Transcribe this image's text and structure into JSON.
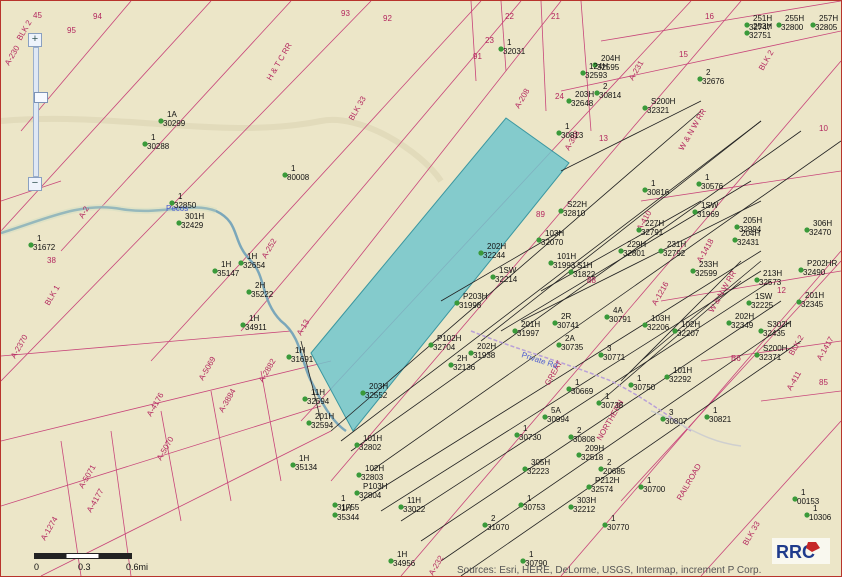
{
  "map": {
    "block_labels": [
      "BLK 2",
      "BLK 33",
      "BLK 1",
      "BLK 33",
      "BLK 2",
      "BLK 2",
      "BLK 33"
    ],
    "railroad_labels": [
      "H & T C RR",
      "W & N W RR",
      "W & N W RR",
      "NORTHERN",
      "RAILROAD",
      "GREAT"
    ],
    "survey_abstracts": [
      "A-230",
      "A-208",
      "A-388",
      "A-231",
      "A-2",
      "A-232",
      "A-252",
      "A-13",
      "A-2370",
      "A-5069",
      "A-2882",
      "A-3884",
      "A-4176",
      "A-5070",
      "A-5071",
      "A-4177",
      "A-1274",
      "A-1216",
      "A-1418",
      "A-410",
      "A-411",
      "A-1417",
      "A-232"
    ],
    "section_numbers": [
      "45",
      "95",
      "94",
      "93",
      "92",
      "91",
      "23",
      "22",
      "21",
      "16",
      "15",
      "24",
      "13",
      "10",
      "12",
      "B6",
      "85",
      "89",
      "88",
      "38"
    ],
    "well_labels": [
      {
        "id": "1",
        "api": "32031"
      },
      {
        "id": "204H",
        "api": "32595"
      },
      {
        "id": "124H",
        "api": "32593"
      },
      {
        "id": "2",
        "api": "30814"
      },
      {
        "id": "2",
        "api": "32676"
      },
      {
        "id": "251H",
        "api": "32747"
      },
      {
        "id": "253H",
        "api": "32751"
      },
      {
        "id": "255H",
        "api": "32800"
      },
      {
        "id": "257H",
        "api": "32805"
      },
      {
        "id": "203H",
        "api": "32648"
      },
      {
        "id": "1A",
        "api": "30299"
      },
      {
        "id": "1",
        "api": "30288"
      },
      {
        "id": "1",
        "api": "80008"
      },
      {
        "id": "1",
        "api": "30813"
      },
      {
        "id": "S200H",
        "api": "32321"
      },
      {
        "id": "1",
        "api": "32850"
      },
      {
        "id": "1",
        "api": "31672"
      },
      {
        "id": "301H",
        "api": "32429"
      },
      {
        "id": "1",
        "api": "30816"
      },
      {
        "id": "1",
        "api": "30576"
      },
      {
        "id": "1SW",
        "api": "31969"
      },
      {
        "id": "1H",
        "api": "32654"
      },
      {
        "id": "1H",
        "api": "35147"
      },
      {
        "id": "2H",
        "api": "35222"
      },
      {
        "id": "1H",
        "api": "34911"
      },
      {
        "id": "202H",
        "api": "32244"
      },
      {
        "id": "1SW",
        "api": "32214"
      },
      {
        "id": "S22H",
        "api": "32810"
      },
      {
        "id": "103H",
        "api": "32070"
      },
      {
        "id": "101H",
        "api": "31993"
      },
      {
        "id": "S1H",
        "api": "31822"
      },
      {
        "id": "227H",
        "api": "32791"
      },
      {
        "id": "229H",
        "api": "32801"
      },
      {
        "id": "231H",
        "api": "32792"
      },
      {
        "id": "233H",
        "api": "32599"
      },
      {
        "id": "205H",
        "api": "32994"
      },
      {
        "id": "204H",
        "api": "32431"
      },
      {
        "id": "213H",
        "api": "32573"
      },
      {
        "id": "306H",
        "api": "32470"
      },
      {
        "id": "P202HR",
        "api": "32490"
      },
      {
        "id": "P203H",
        "api": "31998"
      },
      {
        "id": "201H",
        "api": "31997"
      },
      {
        "id": "2R",
        "api": "30741"
      },
      {
        "id": "4A",
        "api": "30791"
      },
      {
        "id": "1SW",
        "api": "32225"
      },
      {
        "id": "201H",
        "api": "32345"
      },
      {
        "id": "202H",
        "api": "32349"
      },
      {
        "id": "S302H",
        "api": "32435"
      },
      {
        "id": "S200H",
        "api": "32371"
      },
      {
        "id": "103H",
        "api": "32206"
      },
      {
        "id": "102H",
        "api": "32207"
      },
      {
        "id": "101H",
        "api": "32292"
      },
      {
        "id": "1H",
        "api": "31691"
      },
      {
        "id": "P102H",
        "api": "32704"
      },
      {
        "id": "202H",
        "api": "31938"
      },
      {
        "id": "2H",
        "api": "32136"
      },
      {
        "id": "2A",
        "api": "30735"
      },
      {
        "id": "3",
        "api": "30771"
      },
      {
        "id": "1",
        "api": "30750"
      },
      {
        "id": "1",
        "api": "30669"
      },
      {
        "id": "11H",
        "api": "32594"
      },
      {
        "id": "203H",
        "api": "32552"
      },
      {
        "id": "201H",
        "api": "32594"
      },
      {
        "id": "1",
        "api": "30738"
      },
      {
        "id": "5A",
        "api": "30994"
      },
      {
        "id": "3",
        "api": "30807"
      },
      {
        "id": "1",
        "api": "30821"
      },
      {
        "id": "101H",
        "api": "32802"
      },
      {
        "id": "1",
        "api": "30730"
      },
      {
        "id": "2",
        "api": "30808"
      },
      {
        "id": "1H",
        "api": "35134"
      },
      {
        "id": "102H",
        "api": "32803"
      },
      {
        "id": "305H",
        "api": "32223"
      },
      {
        "id": "209H",
        "api": "32518"
      },
      {
        "id": "2",
        "api": "20685"
      },
      {
        "id": "P212H",
        "api": "32574"
      },
      {
        "id": "1",
        "api": "30700"
      },
      {
        "id": "P103H",
        "api": "32804"
      },
      {
        "id": "1",
        "api": "31755"
      },
      {
        "id": "1H",
        "api": "35344"
      },
      {
        "id": "11H",
        "api": "33022"
      },
      {
        "id": "1",
        "api": "30753"
      },
      {
        "id": "303H",
        "api": "32212"
      },
      {
        "id": "1",
        "api": "30770"
      },
      {
        "id": "1",
        "api": "00153"
      },
      {
        "id": "1",
        "api": "10306"
      },
      {
        "id": "2",
        "api": "31070"
      },
      {
        "id": "1H",
        "api": "34956"
      },
      {
        "id": "1",
        "api": "30790"
      }
    ],
    "road_label": "Private Rd",
    "creek_label": "Pecos",
    "colors": {
      "land": "#ece6c8",
      "lease": "#72c6cc",
      "survey": "#c8467a",
      "well": "#3a9a3a",
      "line": "#222222"
    }
  },
  "zoom": {
    "in_label": "+",
    "out_label": "−"
  },
  "scale": {
    "labels": [
      "0",
      "0.3",
      "0.6mi"
    ]
  },
  "attribution": "Sources: Esri, HERE, DeLorme, USGS, Intermap, increment P Corp.",
  "logo": {
    "text": "RRC"
  }
}
